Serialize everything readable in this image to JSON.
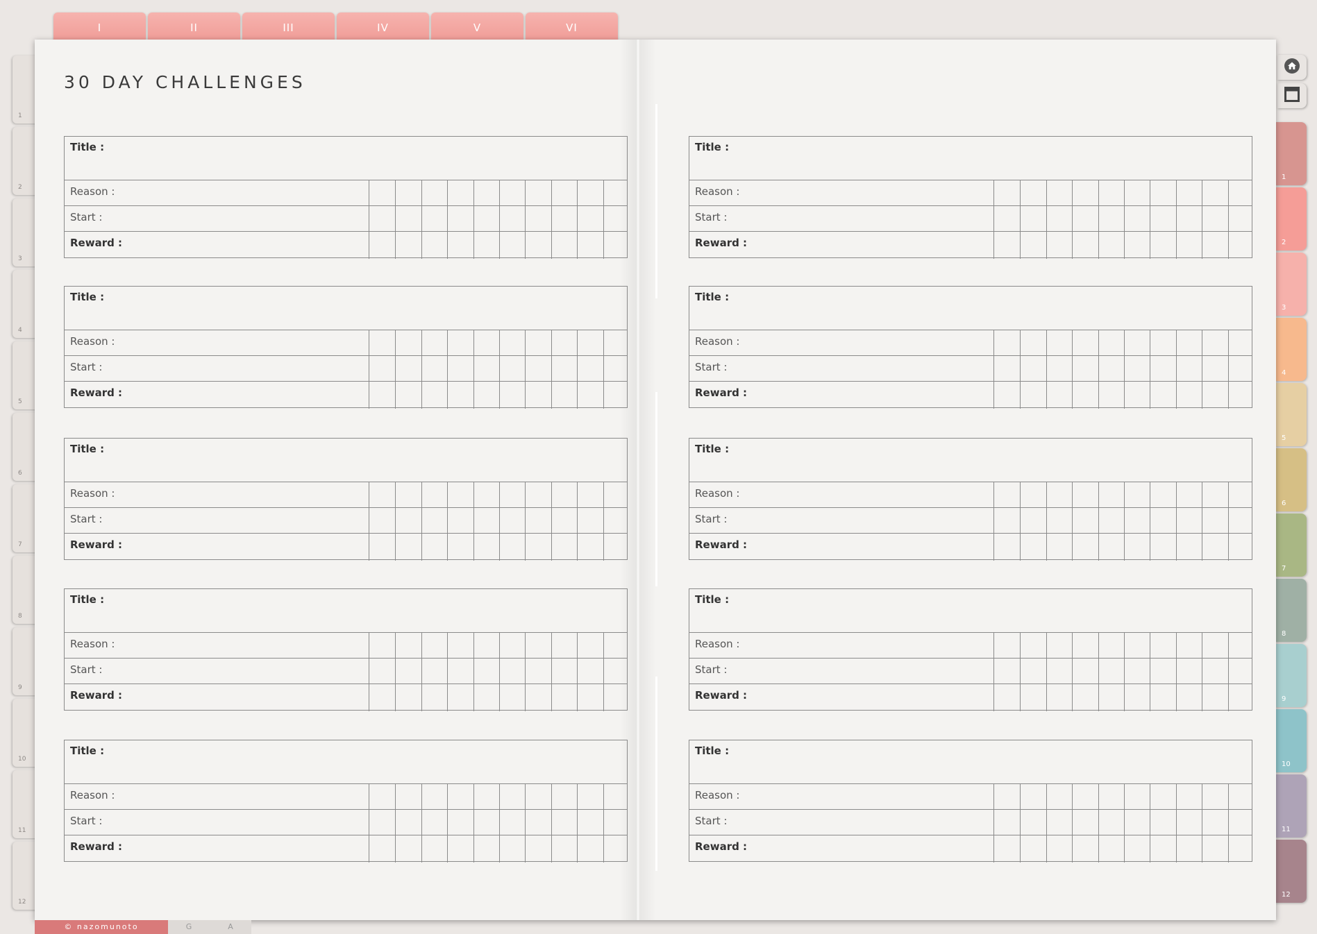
{
  "page_title": "30 DAY CHALLENGES",
  "top_tabs": [
    "I",
    "II",
    "III",
    "IV",
    "V",
    "VI"
  ],
  "left_tabs": [
    "1",
    "2",
    "3",
    "4",
    "5",
    "6",
    "7",
    "8",
    "9",
    "10",
    "11",
    "12"
  ],
  "right_tabs": [
    {
      "label": "1",
      "color": "#d79590"
    },
    {
      "label": "2",
      "color": "#f59d97"
    },
    {
      "label": "3",
      "color": "#f6b1ab"
    },
    {
      "label": "4",
      "color": "#f7b98d"
    },
    {
      "label": "5",
      "color": "#e6cfa3"
    },
    {
      "label": "6",
      "color": "#d6bf85"
    },
    {
      "label": "7",
      "color": "#a9b784"
    },
    {
      "label": "8",
      "color": "#9fb0a5"
    },
    {
      "label": "9",
      "color": "#a8cfcf"
    },
    {
      "label": "10",
      "color": "#8ec3c9"
    },
    {
      "label": "11",
      "color": "#aea3b7"
    },
    {
      "label": "12",
      "color": "#a7848c"
    }
  ],
  "utility_buttons": [
    "home-icon",
    "window-icon"
  ],
  "labels": {
    "title": "Title :",
    "reason": "Reason :",
    "start": "Start :",
    "reward": "Reward :"
  },
  "challenge_count": 10,
  "grid_columns": 10,
  "footer": {
    "brand": "© nazomunoto",
    "tabs": [
      "G",
      "A"
    ]
  }
}
